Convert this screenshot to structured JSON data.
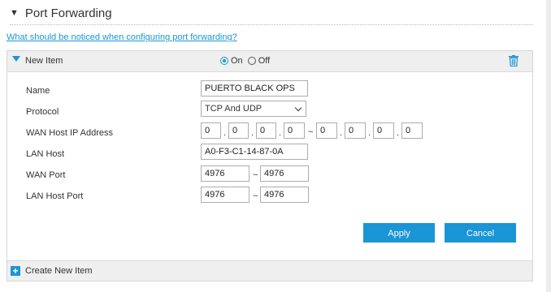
{
  "section": {
    "title": "Port Forwarding"
  },
  "help_link": "What should be noticed when configuring port forwarding?",
  "item": {
    "title": "New Item",
    "on_label": "On",
    "off_label": "Off",
    "selected": "On"
  },
  "form": {
    "name_label": "Name",
    "name_value": "PUERTO BLACK OPS",
    "protocol_label": "Protocol",
    "protocol_value": "TCP And UDP",
    "wan_ip_label": "WAN Host IP Address",
    "wan_ip_start": [
      "0",
      "0",
      "0",
      "0"
    ],
    "wan_ip_end": [
      "0",
      "0",
      "0",
      "0"
    ],
    "lan_host_label": "LAN Host",
    "lan_host_value": "A0-F3-C1-14-87-0A",
    "wan_port_label": "WAN Port",
    "wan_port_start": "4976",
    "wan_port_end": "4976",
    "lan_port_label": "LAN Host Port",
    "lan_port_start": "4976",
    "lan_port_end": "4976",
    "range_sep": "~",
    "dot": "."
  },
  "buttons": {
    "apply": "Apply",
    "cancel": "Cancel"
  },
  "create_new": "Create New Item",
  "colors": {
    "accent": "#1a95d6",
    "header_bg": "#efefef"
  }
}
